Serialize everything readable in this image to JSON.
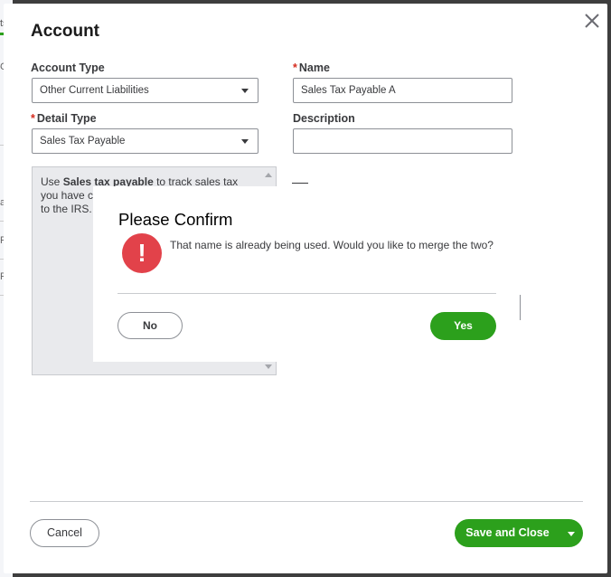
{
  "background": {
    "tab_fragment": "ts",
    "fragments": [
      "C",
      "ab",
      "Pa",
      "Pa"
    ]
  },
  "dialog": {
    "title": "Account",
    "close_icon": "close-icon"
  },
  "form": {
    "account_type": {
      "label": "Account Type",
      "value": "Other Current Liabilities"
    },
    "name": {
      "required_mark": "*",
      "label": "Name",
      "value": "Sales Tax Payable A"
    },
    "detail_type": {
      "required_mark": "*",
      "label": "Detail Type",
      "value": "Sales Tax Payable"
    },
    "description": {
      "label": "Description",
      "value": ""
    }
  },
  "help": {
    "prefix": "Use ",
    "bold": "Sales tax payable",
    "rest": " to track sales tax you have c",
    "line3": "to the IRS."
  },
  "confirm": {
    "title": "Please Confirm",
    "icon": "exclamation-icon",
    "message": "That name is already being used. Would you like to merge the two?",
    "no_label": "No",
    "yes_label": "Yes"
  },
  "footer": {
    "cancel_label": "Cancel",
    "save_label": "Save and Close"
  },
  "colors": {
    "primary_green": "#2ca01c",
    "warning_red": "#e2424a",
    "required_red": "#d52b1e"
  }
}
